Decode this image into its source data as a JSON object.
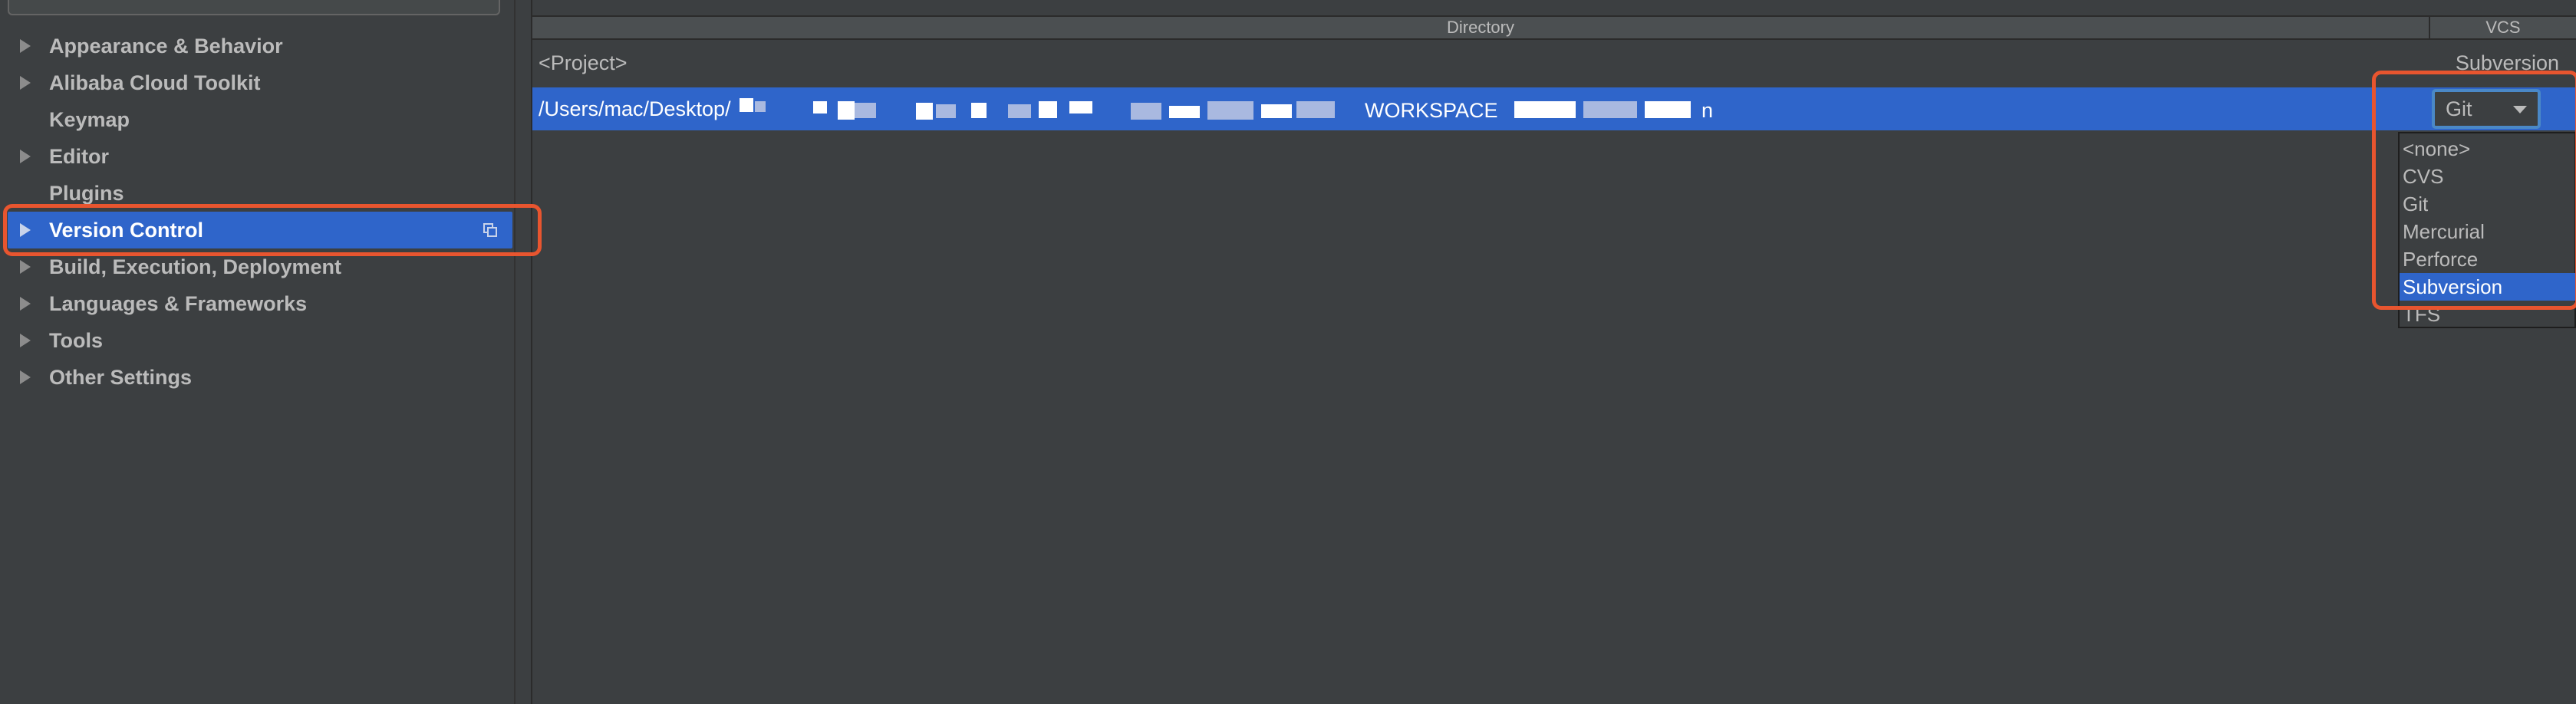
{
  "sidebar": {
    "items": [
      {
        "label": "Appearance & Behavior",
        "expandable": true
      },
      {
        "label": "Alibaba Cloud Toolkit",
        "expandable": true
      },
      {
        "label": "Keymap",
        "expandable": false
      },
      {
        "label": "Editor",
        "expandable": true
      },
      {
        "label": "Plugins",
        "expandable": false
      },
      {
        "label": "Version Control",
        "expandable": true,
        "selected": true
      },
      {
        "label": "Build, Execution, Deployment",
        "expandable": true
      },
      {
        "label": "Languages & Frameworks",
        "expandable": true
      },
      {
        "label": "Tools",
        "expandable": true
      },
      {
        "label": "Other Settings",
        "expandable": true
      }
    ]
  },
  "table": {
    "headers": {
      "directory": "Directory",
      "vcs": "VCS"
    },
    "rows": [
      {
        "directory": "<Project>",
        "vcs": "Subversion"
      },
      {
        "directory": "/Users/mac/Desktop/",
        "directory_visible_fragments": [
          "WORKSPACE",
          "n"
        ],
        "vcs": "Git",
        "selected": true
      }
    ]
  },
  "vcs_combo": {
    "value": "Git"
  },
  "vcs_dropdown": {
    "options": [
      "<none>",
      "CVS",
      "Git",
      "Mercurial",
      "Perforce",
      "Subversion",
      "TFS"
    ],
    "selected": "Subversion"
  },
  "colors": {
    "background": "#3c3f41",
    "selection": "#2f65ca",
    "highlight_annotation": "#e8552f",
    "combo_focus": "#4a88c7"
  }
}
